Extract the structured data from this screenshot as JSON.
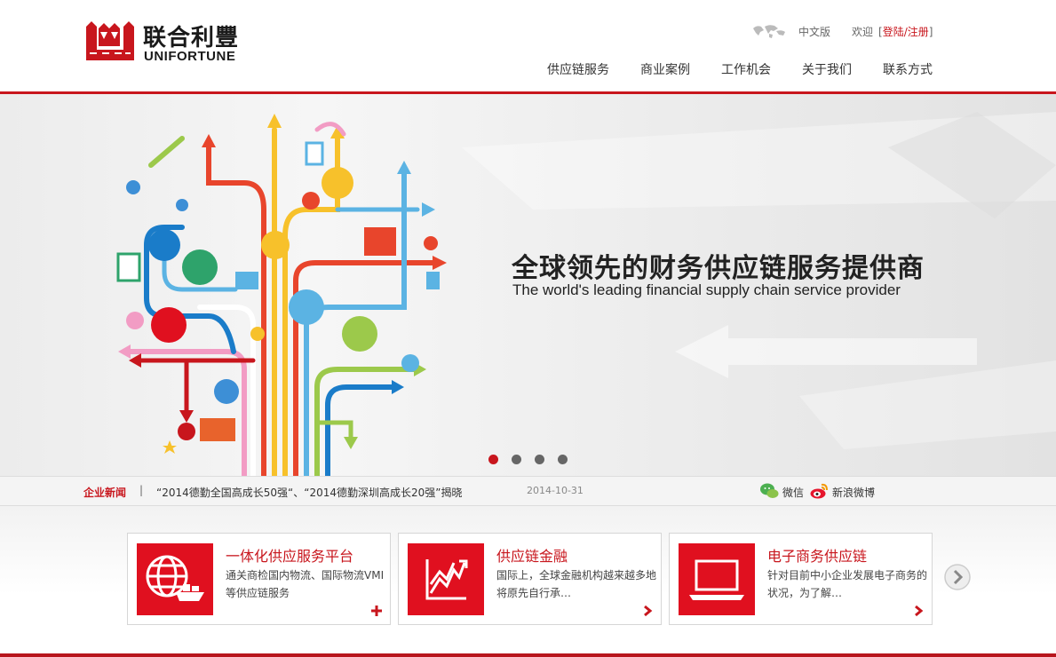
{
  "brand": {
    "name_cn": "联合利豐",
    "name_en": "UNIFORTUNE",
    "color": "#c8161d"
  },
  "top_links": {
    "language": "中文版",
    "welcome": "欢迎",
    "bracket_open": "[",
    "login": "登陆/注册",
    "bracket_close": "]"
  },
  "nav": {
    "items": [
      {
        "label": "供应链服务"
      },
      {
        "label": "商业案例"
      },
      {
        "label": "工作机会"
      },
      {
        "label": "关于我们"
      },
      {
        "label": "联系方式"
      }
    ]
  },
  "banner": {
    "title": "全球领先的财务供应链服务提供商",
    "subtitle": "The world's leading financial supply chain service provider",
    "slides_total": 4,
    "active_slide": 1
  },
  "news": {
    "label": "企业新闻",
    "separator": "|",
    "headline": "“2014德勤全国高成长50强“、“2014德勤深圳高成长20强”揭晓",
    "date": "2014-10-31",
    "wechat": "微信",
    "weibo": "新浪微博"
  },
  "services": [
    {
      "title": "一体化供应服务平台",
      "desc": "通关商检国内物流、国际物流VMI等供应链服务",
      "icon": "globe-ship-icon",
      "more_icon": "plus-icon"
    },
    {
      "title": "供应链金融",
      "desc": "国际上，全球金融机构越来越多地将原先自行承…",
      "icon": "growth-chart-icon",
      "more_icon": "chevron-right-icon"
    },
    {
      "title": "电子商务供应链",
      "desc": "针对目前中小企业发展电子商务的状况，为了解…",
      "icon": "laptop-icon",
      "more_icon": "chevron-right-icon"
    }
  ]
}
